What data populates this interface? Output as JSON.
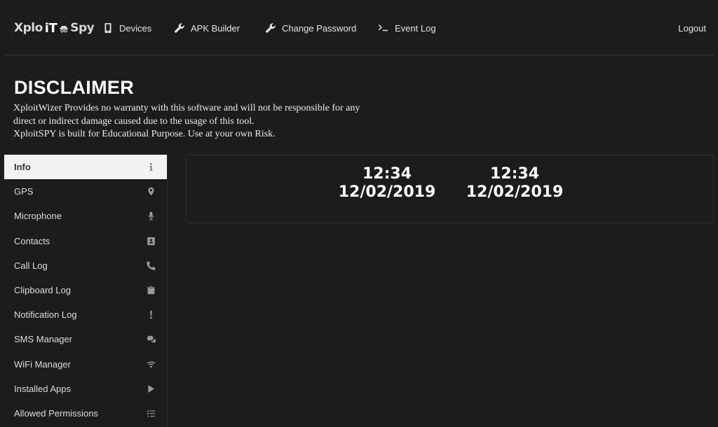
{
  "app": {
    "logo_left": "Xplo",
    "logo_mid": "iT",
    "logo_right": "Spy"
  },
  "nav": {
    "items": [
      {
        "label": "Devices",
        "icon": "mobile-icon"
      },
      {
        "label": "APK Builder",
        "icon": "wrench-icon"
      },
      {
        "label": "Change Password",
        "icon": "wrench-icon"
      },
      {
        "label": "Event Log",
        "icon": "terminal-icon"
      }
    ],
    "logout": "Logout"
  },
  "disclaimer": {
    "title": "DISCLAIMER",
    "line1": "XploitWizer Provides no warranty with this software and will not be responsible for any direct or indirect damage caused due to the usage of this tool.",
    "line2": "XploitSPY is built for Educational Purpose. Use at your own Risk."
  },
  "sidebar": {
    "items": [
      {
        "label": "Info",
        "icon": "info-icon",
        "active": true
      },
      {
        "label": "GPS",
        "icon": "map-marker-icon"
      },
      {
        "label": "Microphone",
        "icon": "microphone-icon"
      },
      {
        "label": "Contacts",
        "icon": "address-book-icon"
      },
      {
        "label": "Call Log",
        "icon": "phone-icon"
      },
      {
        "label": "Clipboard Log",
        "icon": "clipboard-icon"
      },
      {
        "label": "Notification Log",
        "icon": "exclamation-icon"
      },
      {
        "label": "SMS Manager",
        "icon": "comments-icon"
      },
      {
        "label": "WiFi Manager",
        "icon": "wifi-icon"
      },
      {
        "label": "Installed Apps",
        "icon": "play-icon"
      },
      {
        "label": "Allowed Permissions",
        "icon": "list-check-icon"
      }
    ]
  },
  "info": {
    "clocks": [
      {
        "time": "12:34",
        "date": "12/02/2019"
      },
      {
        "time": "12:34",
        "date": "12/02/2019"
      }
    ]
  }
}
